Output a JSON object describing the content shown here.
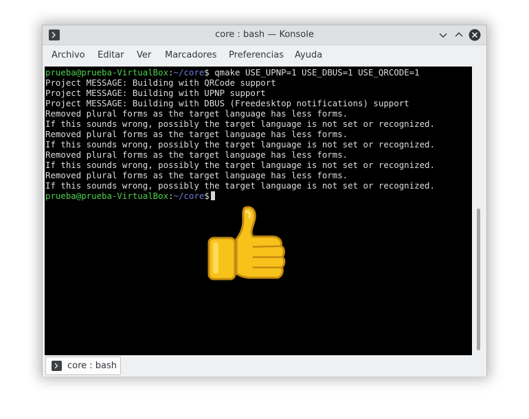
{
  "window": {
    "title": "core : bash — Konsole",
    "icon": "terminal-icon",
    "controls": [
      "minimize-icon",
      "maximize-icon",
      "close-icon"
    ]
  },
  "menubar": {
    "items": [
      "Archivo",
      "Editar",
      "Ver",
      "Marcadores",
      "Preferencias",
      "Ayuda"
    ]
  },
  "terminal": {
    "prompt_user": "prueba@prueba-VirtualBox",
    "prompt_sep": ":",
    "prompt_path": "~/core",
    "prompt_symbol": "$",
    "command": " qmake USE_UPNP=1 USE_DBUS=1 USE_QRCODE=1",
    "output": [
      "Project MESSAGE: Building with QRCode support",
      "Project MESSAGE: Building with UPNP support",
      "Project MESSAGE: Building with DBUS (Freedesktop notifications) support",
      "Removed plural forms as the target language has less forms.",
      "If this sounds wrong, possibly the target language is not set or recognized.",
      "Removed plural forms as the target language has less forms.",
      "If this sounds wrong, possibly the target language is not set or recognized.",
      "Removed plural forms as the target language has less forms.",
      "If this sounds wrong, possibly the target language is not set or recognized.",
      "Removed plural forms as the target language has less forms.",
      "If this sounds wrong, possibly the target language is not set or recognized."
    ],
    "overlay_icon": "thumbs-up-icon"
  },
  "tabs": [
    {
      "label": "core : bash",
      "icon": "terminal-icon"
    }
  ],
  "colors": {
    "prompt_user": "#4ed24e",
    "prompt_path": "#6f7fd8",
    "terminal_bg": "#000000",
    "terminal_fg": "#dedede"
  }
}
